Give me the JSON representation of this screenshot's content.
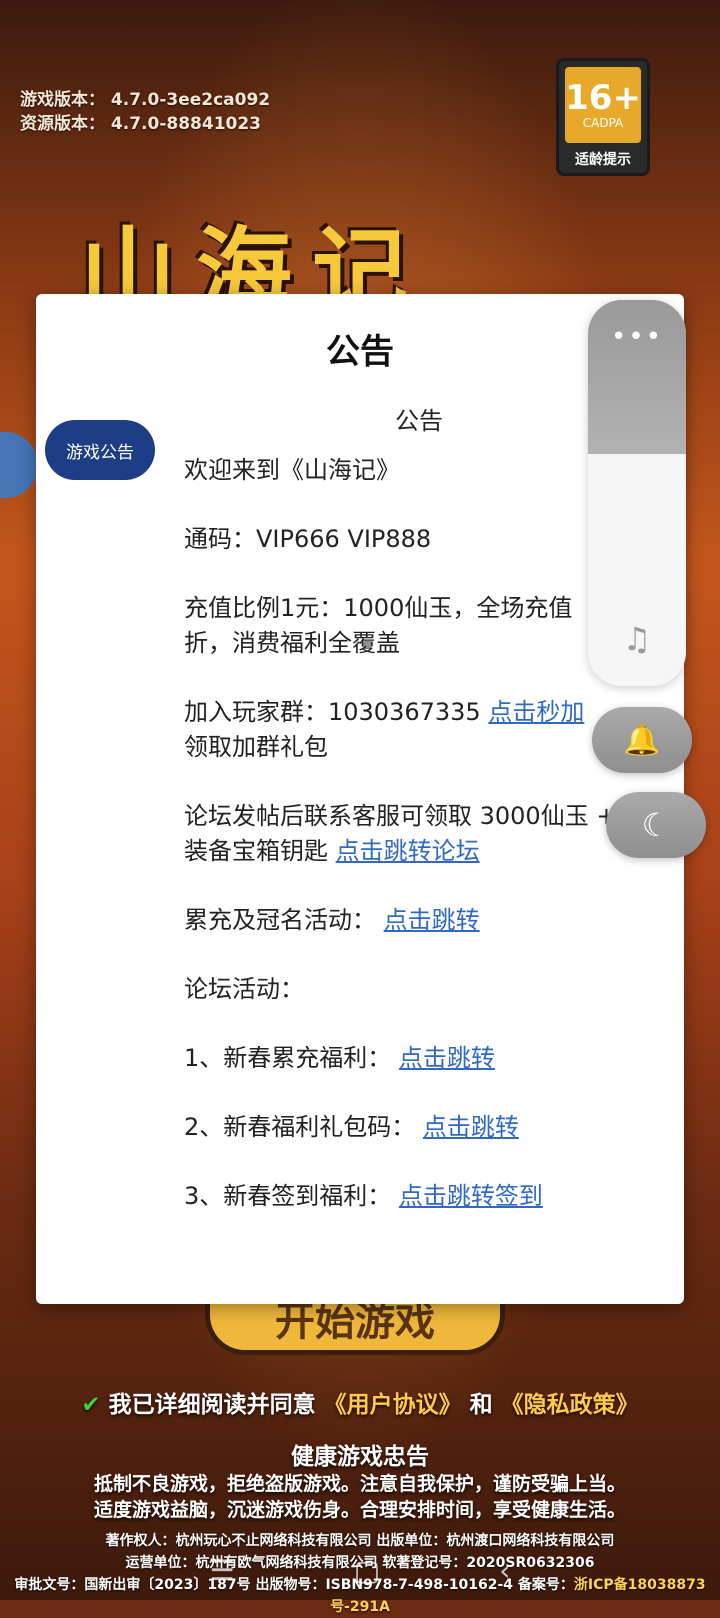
{
  "background": {
    "version_lines": [
      "游戏版本： 4.7.0-3ee2ca092",
      "资源版本： 4.7.0-88841023"
    ],
    "age_badge": {
      "age": "16+",
      "org": "CADPA",
      "tip": "适龄提示"
    },
    "logo": "山海记",
    "start_button": "开始游戏",
    "agree": {
      "check": "✔",
      "prefix": "我已详细阅读并同意",
      "user_agreement": "《用户协议》",
      "and": "和",
      "privacy": "《隐私政策》"
    },
    "health": {
      "title": "健康游戏忠告",
      "line1": "抵制不良游戏，拒绝盗版游戏。注意自我保护，谨防受骗上当。",
      "line2": "适度游戏益脑，沉迷游戏伤身。合理安排时间，享受健康生活。"
    },
    "credits": {
      "line1": "著作权人：杭州玩心不止网络科技有限公司  出版单位：杭州渡口网络科技有限公司",
      "line2": "运营单位：杭州有欧气网络科技有限公司  软著登记号：2020SR0632306",
      "line3_prefix": "审批文号：国新出审〔2023〕187号 出版物号：ISBN978-7-498-10162-4 备案号：",
      "line3_icp": "浙ICP备18038873号-291A"
    }
  },
  "nav": {
    "menu_icon": "☰",
    "home_icon": "▢",
    "back_icon": "‹"
  },
  "dialog": {
    "title": "公告",
    "side_tab": "游戏公告",
    "announcement_title": "公告",
    "welcome": "欢迎来到《山海记》",
    "codes": "通码：VIP666 VIP888",
    "recharge": "充值比例1元：1000仙玉，全场充值",
    "recharge_tail": "折，消费福利全覆盖",
    "group_text": "加入玩家群：1030367335 ",
    "group_link": "点击秒加",
    "group_tail": "领取加群礼包",
    "forum_text": "论坛发帖后联系客服可领取 3000仙玉 +10装备宝箱钥匙 ",
    "forum_link": "点击跳转论坛",
    "accum_text": "累充及冠名活动：  ",
    "accum_link": "点击跳转",
    "forum_activity": "论坛活动：",
    "item1_text": "1、新春累充福利：  ",
    "item1_link": "点击跳转",
    "item2_text": "2、新春福利礼包码：  ",
    "item2_link": "点击跳转",
    "item3_text": "3、新春签到福利：  ",
    "item3_link": "点击跳转签到"
  },
  "float": {
    "more_icon": "•••",
    "music_icon": "♫",
    "bell_icon": "🔔",
    "moon_icon": "☾"
  }
}
